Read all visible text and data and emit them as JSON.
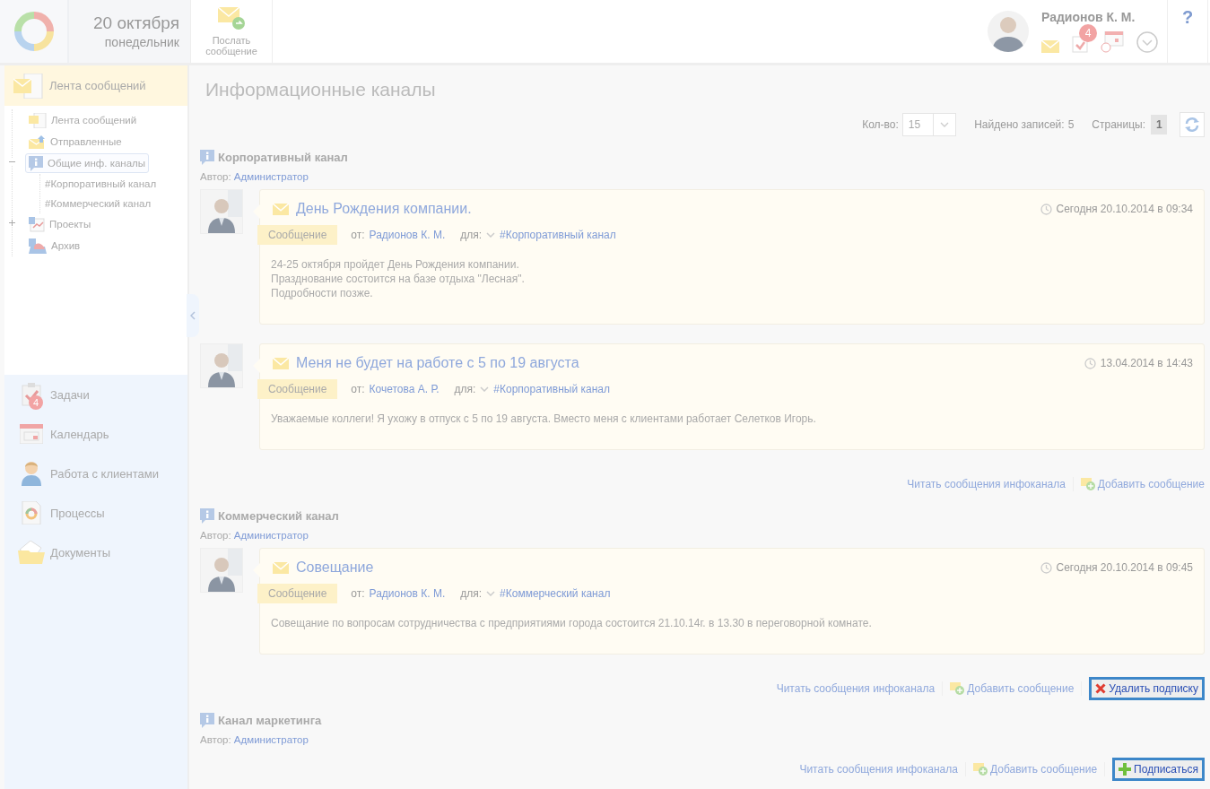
{
  "header": {
    "date": "20 октября",
    "weekday": "понедельник",
    "send_button": "Послать сообщение",
    "user_name": "Радионов К. М.",
    "tasks_badge": "4",
    "help": "?"
  },
  "sidebar": {
    "section": "Лента сообщений",
    "tree": [
      {
        "kind": "feed",
        "label": "Лента сообщений",
        "selected": false
      },
      {
        "kind": "sent",
        "label": "Отправленные",
        "selected": false
      },
      {
        "kind": "channels",
        "label": "Общие инф. каналы",
        "selected": true,
        "expanded": true,
        "children": [
          {
            "label": "#Корпоративный канал",
            "selected": false
          },
          {
            "label": "#Коммерческий канал",
            "selected": false
          }
        ]
      },
      {
        "kind": "projects",
        "label": "Проекты",
        "selected": false,
        "expanded": false
      },
      {
        "kind": "archive",
        "label": "Архив",
        "selected": false
      }
    ],
    "nav": [
      {
        "kind": "tasks",
        "label": "Задачи",
        "badge": "4"
      },
      {
        "kind": "calendar",
        "label": "Календарь"
      },
      {
        "kind": "clients",
        "label": "Работа с клиентами"
      },
      {
        "kind": "processes",
        "label": "Процессы"
      },
      {
        "kind": "documents",
        "label": "Документы"
      }
    ]
  },
  "main": {
    "title": "Информационные каналы",
    "toolbar": {
      "count_label": "Кол-во:",
      "count_value": "15",
      "found_label": "Найдено записей:",
      "found_value": "5",
      "pages_label": "Страницы:",
      "page": "1"
    },
    "channels": [
      {
        "title": "Корпоративный канал",
        "author_label": "Автор:",
        "author": "Администратор",
        "messages": [
          {
            "title": "День Рождения компании.",
            "date": "Сегодня 20.10.2014 в 09:34",
            "tag": "Сообщение",
            "from_label": "от:",
            "from": "Радионов К. М.",
            "to_label": "для:",
            "to": "#Корпоративный канал",
            "body": [
              "24-25 октября пройдет День Рождения компании.",
              "Празднование состоится на базе отдыха \"Лесная\".",
              "Подробности позже."
            ]
          },
          {
            "title": "Меня не будет на работе с 5 по 19 августа",
            "date": "13.04.2014 в 14:43",
            "tag": "Сообщение",
            "from_label": "от:",
            "from": "Кочетова А. Р.",
            "to_label": "для:",
            "to": "#Корпоративный канал",
            "body": [
              "Уважаемые коллеги! Я ухожу в отпуск с 5 по 19 августа. Вместо меня с клиентами работает Селетков Игорь."
            ]
          }
        ],
        "actions": [
          {
            "kind": "read",
            "label": "Читать сообщения инфоканала",
            "highlighted": false
          },
          {
            "kind": "add",
            "label": "Добавить сообщение",
            "highlighted": false
          }
        ]
      },
      {
        "title": "Коммерческий канал",
        "author_label": "Автор:",
        "author": "Администратор",
        "messages": [
          {
            "title": "Совещание",
            "date": "Сегодня 20.10.2014 в 09:45",
            "tag": "Сообщение",
            "from_label": "от:",
            "from": "Радионов К. М.",
            "to_label": "для:",
            "to": "#Коммерческий канал",
            "body": [
              "Совещание по вопросам сотрудничества с предприятиями города состоится 21.10.14г. в 13.30 в переговорной комнате."
            ]
          }
        ],
        "actions": [
          {
            "kind": "read",
            "label": "Читать сообщения инфоканала",
            "highlighted": false
          },
          {
            "kind": "add",
            "label": "Добавить сообщение",
            "highlighted": false
          },
          {
            "kind": "unsubscribe",
            "label": "Удалить подписку",
            "highlighted": true
          }
        ]
      },
      {
        "title": "Канал маркетинга",
        "author_label": "Автор:",
        "author": "Администратор",
        "actions": [
          {
            "kind": "read",
            "label": "Читать сообщения инфоканала",
            "highlighted": false
          },
          {
            "kind": "add",
            "label": "Добавить сообщение",
            "highlighted": false
          },
          {
            "kind": "subscribe",
            "label": "Подписаться",
            "highlighted": true
          }
        ]
      }
    ]
  }
}
